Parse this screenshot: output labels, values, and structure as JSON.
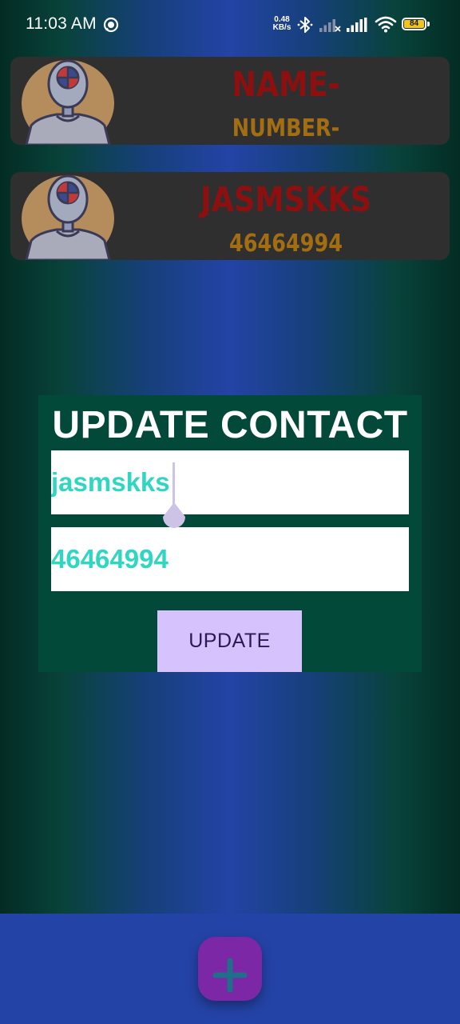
{
  "status_bar": {
    "time": "11:03 AM",
    "network_speed_value": "0.48",
    "network_speed_unit": "KB/s",
    "battery": "84",
    "icons": [
      "whatsapp-icon",
      "bluetooth-icon",
      "signal-icon",
      "signal-icon",
      "wifi-icon",
      "battery-icon"
    ]
  },
  "contacts": [
    {
      "name": "NAME-",
      "number": "NUMBER-",
      "avatar": "robot-avatar"
    },
    {
      "name": "JASMSKKS",
      "number": "46464994",
      "avatar": "robot-avatar"
    }
  ],
  "update_dialog": {
    "title": "UPDATE CONTACT",
    "name_value": "jasmskks",
    "number_value": "46464994",
    "button_label": "UPDATE"
  },
  "fab": {
    "icon": "plus-icon"
  },
  "colors": {
    "card_bg": "#2f2f30",
    "name_text": "#8d1010",
    "number_text": "#a36e12",
    "dialog_bg": "#02493a",
    "field_text": "#2fd6c2",
    "button_bg": "#d6c2fc",
    "bottom_bar": "#2443a6",
    "fab_bg": "#7b27a6"
  }
}
